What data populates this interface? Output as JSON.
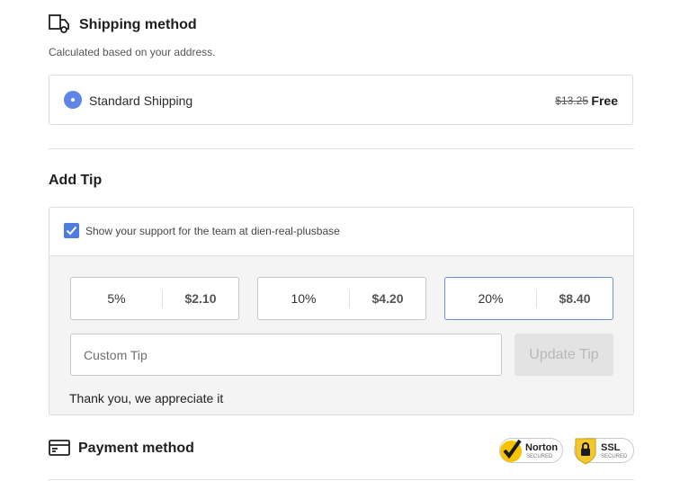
{
  "shipping": {
    "title": "Shipping method",
    "subtitle": "Calculated based on your address.",
    "icon": "truck-icon",
    "options": [
      {
        "label": "Standard Shipping",
        "original_price": "$13.25",
        "price": "Free",
        "selected": true
      }
    ]
  },
  "tip": {
    "title": "Add Tip",
    "support_checked": true,
    "support_text": "Show your support for the team at dien-real-plusbase",
    "options": [
      {
        "percent": "5%",
        "amount": "$2.10",
        "selected": false
      },
      {
        "percent": "10%",
        "amount": "$4.20",
        "selected": false
      },
      {
        "percent": "20%",
        "amount": "$8.40",
        "selected": true
      }
    ],
    "custom_placeholder": "Custom Tip",
    "custom_value": "",
    "update_label": "Update Tip",
    "thanks_text": "Thank you, we appreciate it"
  },
  "payment": {
    "title": "Payment method",
    "icon": "credit-card-icon",
    "badges": [
      {
        "name": "Norton",
        "sub": "SECURED"
      },
      {
        "name": "SSL",
        "sub": "SECURED"
      }
    ]
  },
  "colors": {
    "accent": "#4d7de0",
    "selected_border": "#6c8fd6",
    "panel_bg": "#f4f4f4",
    "norton_yellow": "#f5c300",
    "ssl_yellow": "#f4c82b"
  }
}
